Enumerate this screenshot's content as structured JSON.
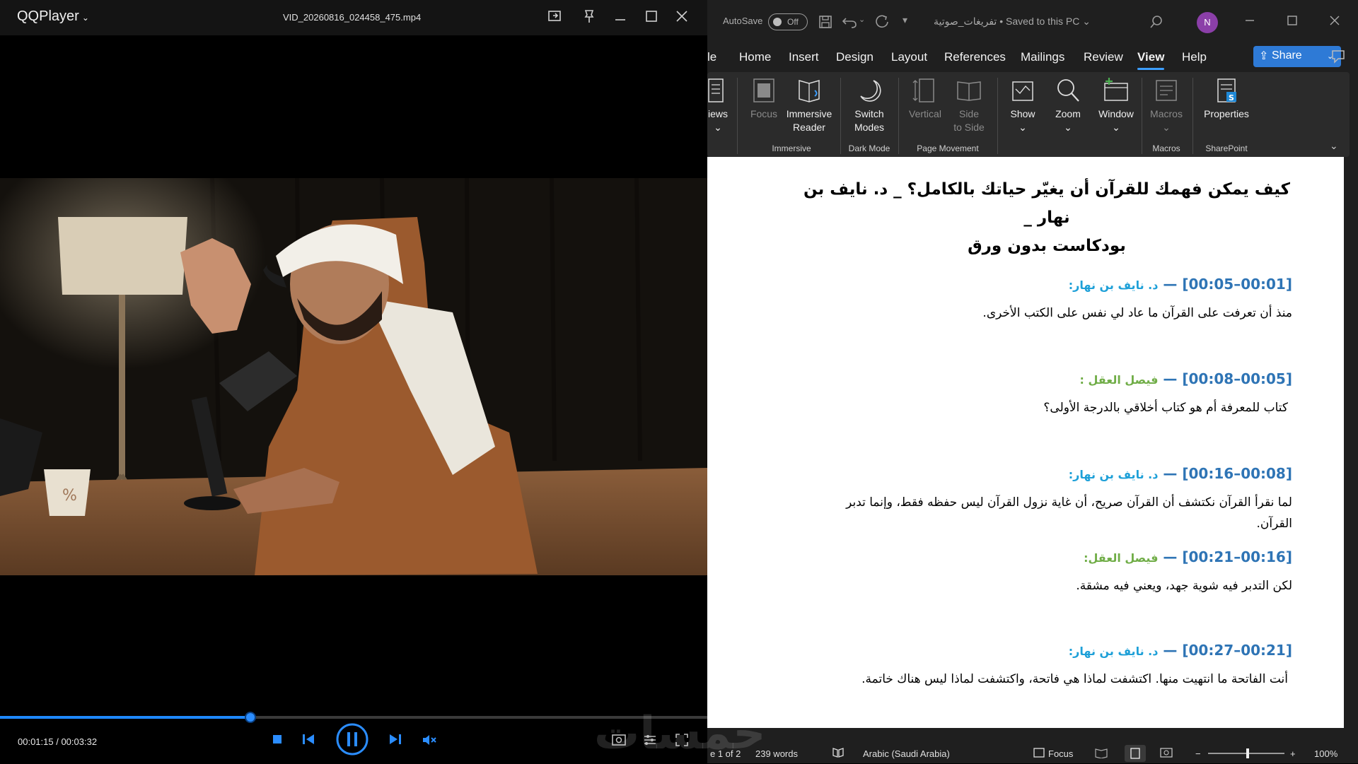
{
  "player": {
    "app_name": "QQPlayer",
    "file_name": "VID_20260816_024458_475.mp4",
    "elapsed": "00:01:15",
    "duration": "00:03:32",
    "time_display": "00:01:15 / 00:03:32",
    "progress_fraction": 0.354,
    "accent_color": "#2b8dff",
    "watermark": "خمسات",
    "cup_label": "%"
  },
  "word": {
    "autosave_label": "AutoSave",
    "autosave_state": "Off",
    "doc_name": "تفريغات_صوتية",
    "save_status": "Saved to this PC",
    "avatar_initial": "N",
    "tabs": [
      "le",
      "Home",
      "Insert",
      "Design",
      "Layout",
      "References",
      "Mailings",
      "Review",
      "View",
      "Help"
    ],
    "active_tab": "View",
    "share_label": "Share",
    "ribbon": {
      "views_label": "iews",
      "focus_label": "Focus",
      "immersive_reader": [
        "Immersive",
        "Reader"
      ],
      "switch_modes": [
        "Switch",
        "Modes"
      ],
      "vertical_label": "Vertical",
      "side_to_side": [
        "Side",
        "to Side"
      ],
      "show_label": "Show",
      "zoom_label": "Zoom",
      "window_label": "Window",
      "macros_label": "Macros",
      "properties_label": "Properties",
      "groups": {
        "immersive": "Immersive",
        "dark_mode": "Dark Mode",
        "page_movement": "Page Movement",
        "macros": "Macros",
        "sharepoint": "SharePoint"
      }
    },
    "document": {
      "title_line1": "كيف يمكن فهمك للقرآن أن يغيّر حياتك بالكامل؟ _ د. نايف بن نهار _",
      "title_line2": "بودكاست بدون ورق",
      "segments": [
        {
          "ts": "[00:01–00:05]",
          "speaker": "د. نايف بن نهار:",
          "speaker_type": "a",
          "text": "منذ أن تعرفت على القرآن ما عاد لي نفس على الكتب الأخرى."
        },
        {
          "ts": "[00:05–00:08]",
          "speaker": "فيصل العقل :",
          "speaker_type": "b",
          "text": "كتاب للمعرفة أم هو كتاب أخلاقي بالدرجة الأولى؟"
        },
        {
          "ts": "[00:08–00:16]",
          "speaker": "د. نايف بن نهار:",
          "speaker_type": "a",
          "text": "لما نقرأ القرآن نكتشف أن القرآن صريح، أن غاية نزول القرآن ليس حفظه فقط، وإنما تدبر القرآن."
        },
        {
          "ts": "[00:16–00:21]",
          "speaker": "فيصل العقل:",
          "speaker_type": "b",
          "text": "لكن التدبر فيه شوية جهد، ويعني فيه مشقة."
        },
        {
          "ts": "[00:21–00:27]",
          "speaker": "د. نايف بن نهار:",
          "speaker_type": "a",
          "text": "أنت الفاتحة ما انتهيت منها. اكتشفت لماذا هي فاتحة، واكتشفت لماذا ليس هناك خاتمة."
        }
      ],
      "dash": "—"
    },
    "status": {
      "page": "e 1 of 2",
      "words": "239 words",
      "language": "Arabic (Saudi Arabia)",
      "focus": "Focus",
      "zoom": "100%"
    }
  }
}
